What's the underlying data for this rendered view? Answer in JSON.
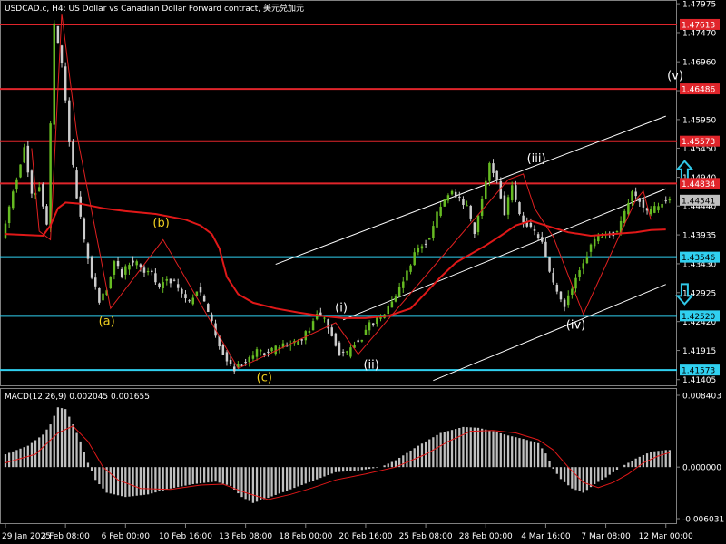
{
  "chart_data": {
    "type": "candlestick",
    "title": "USDCAD.c, H4:  US Dollar vs Canadian Dollar Forward contract, 美元兑加元",
    "price_axis": {
      "ylim": [
        1.4129,
        1.4804
      ],
      "ticks": [
        "1.47975",
        "1.47470",
        "1.46960",
        "1.46455",
        "1.45950",
        "1.45450",
        "1.44940",
        "1.44440",
        "1.43935",
        "1.43430",
        "1.42925",
        "1.42420",
        "1.41915",
        "1.41405"
      ]
    },
    "time_axis": {
      "labels": [
        "29 Jan 2025",
        "3 Feb 08:00",
        "6 Feb 00:00",
        "10 Feb 16:00",
        "13 Feb 08:00",
        "18 Feb 00:00",
        "20 Feb 16:00",
        "25 Feb 08:00",
        "28 Feb 00:00",
        "4 Mar 16:00",
        "7 Mar 08:00",
        "12 Mar 00:00"
      ],
      "positions": [
        0,
        16,
        32,
        48,
        64,
        80,
        96,
        112,
        128,
        144,
        160,
        176
      ]
    },
    "bars_count": 178,
    "current_price": "1.44541",
    "colors": {
      "up": "#66bb22",
      "down": "#cccccc",
      "background": "#000000",
      "resistance": "#e0252b",
      "support": "#30d0f0",
      "moving_average": "#e01818",
      "channel": "#ffffff",
      "histogram": "#c0c0c0",
      "signal": "#e01818",
      "arrows": "#30c8e8"
    },
    "price_anchors": [
      [
        0,
        1.4385
      ],
      [
        3,
        1.447
      ],
      [
        6,
        1.4545
      ],
      [
        8,
        1.446
      ],
      [
        10,
        1.448
      ],
      [
        12,
        1.441
      ],
      [
        14,
        1.476
      ],
      [
        16,
        1.469
      ],
      [
        18,
        1.456
      ],
      [
        20,
        1.446
      ],
      [
        22,
        1.438
      ],
      [
        24,
        1.432
      ],
      [
        26,
        1.4278
      ],
      [
        28,
        1.43
      ],
      [
        30,
        1.4345
      ],
      [
        32,
        1.4325
      ],
      [
        34,
        1.4345
      ],
      [
        36,
        1.4345
      ],
      [
        38,
        1.433
      ],
      [
        40,
        1.4325
      ],
      [
        42,
        1.43
      ],
      [
        44,
        1.432
      ],
      [
        46,
        1.431
      ],
      [
        48,
        1.429
      ],
      [
        50,
        1.4275
      ],
      [
        52,
        1.43
      ],
      [
        54,
        1.4275
      ],
      [
        56,
        1.424
      ],
      [
        58,
        1.42
      ],
      [
        60,
        1.4175
      ],
      [
        62,
        1.416
      ],
      [
        64,
        1.4168
      ],
      [
        66,
        1.418
      ],
      [
        68,
        1.4188
      ],
      [
        70,
        1.419
      ],
      [
        72,
        1.419
      ],
      [
        74,
        1.42
      ],
      [
        76,
        1.42
      ],
      [
        78,
        1.4205
      ],
      [
        80,
        1.421
      ],
      [
        82,
        1.423
      ],
      [
        84,
        1.4255
      ],
      [
        86,
        1.4245
      ],
      [
        88,
        1.422
      ],
      [
        90,
        1.419
      ],
      [
        92,
        1.4185
      ],
      [
        94,
        1.4205
      ],
      [
        96,
        1.4215
      ],
      [
        98,
        1.4235
      ],
      [
        100,
        1.4245
      ],
      [
        102,
        1.426
      ],
      [
        104,
        1.428
      ],
      [
        106,
        1.43
      ],
      [
        108,
        1.433
      ],
      [
        110,
        1.436
      ],
      [
        112,
        1.4375
      ],
      [
        114,
        1.439
      ],
      [
        116,
        1.443
      ],
      [
        118,
        1.4455
      ],
      [
        120,
        1.4465
      ],
      [
        122,
        1.4455
      ],
      [
        124,
        1.444
      ],
      [
        126,
        1.4395
      ],
      [
        128,
        1.4455
      ],
      [
        130,
        1.452
      ],
      [
        132,
        1.449
      ],
      [
        134,
        1.443
      ],
      [
        136,
        1.448
      ],
      [
        138,
        1.443
      ],
      [
        140,
        1.441
      ],
      [
        142,
        1.4395
      ],
      [
        144,
        1.438
      ],
      [
        146,
        1.433
      ],
      [
        148,
        1.429
      ],
      [
        150,
        1.427
      ],
      [
        152,
        1.43
      ],
      [
        154,
        1.433
      ],
      [
        156,
        1.436
      ],
      [
        158,
        1.4385
      ],
      [
        160,
        1.439
      ],
      [
        162,
        1.4395
      ],
      [
        164,
        1.44
      ],
      [
        166,
        1.443
      ],
      [
        168,
        1.447
      ],
      [
        170,
        1.4455
      ],
      [
        172,
        1.443
      ],
      [
        174,
        1.444
      ],
      [
        176,
        1.445
      ],
      [
        177,
        1.4454
      ]
    ],
    "moving_average": [
      [
        0,
        1.4395
      ],
      [
        10,
        1.4392
      ],
      [
        12,
        1.441
      ],
      [
        14,
        1.444
      ],
      [
        16,
        1.445
      ],
      [
        20,
        1.4448
      ],
      [
        26,
        1.444
      ],
      [
        32,
        1.4435
      ],
      [
        40,
        1.443
      ],
      [
        48,
        1.442
      ],
      [
        52,
        1.441
      ],
      [
        55,
        1.4395
      ],
      [
        57,
        1.437
      ],
      [
        59,
        1.432
      ],
      [
        62,
        1.429
      ],
      [
        66,
        1.4275
      ],
      [
        72,
        1.4265
      ],
      [
        78,
        1.4258
      ],
      [
        84,
        1.4252
      ],
      [
        90,
        1.4248
      ],
      [
        96,
        1.4248
      ],
      [
        102,
        1.4252
      ],
      [
        108,
        1.4265
      ],
      [
        112,
        1.4292
      ],
      [
        116,
        1.432
      ],
      [
        120,
        1.4345
      ],
      [
        124,
        1.436
      ],
      [
        128,
        1.4375
      ],
      [
        132,
        1.4392
      ],
      [
        136,
        1.441
      ],
      [
        140,
        1.4418
      ],
      [
        144,
        1.441
      ],
      [
        150,
        1.4398
      ],
      [
        156,
        1.4392
      ],
      [
        162,
        1.4395
      ],
      [
        168,
        1.4398
      ],
      [
        172,
        1.4402
      ],
      [
        176,
        1.4403
      ]
    ],
    "horizontal_levels": [
      {
        "label": "1.47613",
        "value": 1.47613,
        "kind": "resistance"
      },
      {
        "label": "1.46486",
        "value": 1.46486,
        "kind": "resistance"
      },
      {
        "label": "1.45573",
        "value": 1.45573,
        "kind": "resistance"
      },
      {
        "label": "1.44834",
        "value": 1.44834,
        "kind": "resistance"
      },
      {
        "label": "1.43546",
        "value": 1.43546,
        "kind": "support"
      },
      {
        "label": "1.42520",
        "value": 1.4252,
        "kind": "support"
      },
      {
        "label": "1.41573",
        "value": 1.41573,
        "kind": "support"
      }
    ],
    "channel_lines": [
      {
        "x1": 72,
        "y1": 1.4342,
        "x2": 176,
        "y2": 1.4601
      },
      {
        "x1": 114,
        "y1": 1.4139,
        "x2": 176,
        "y2": 1.4307
      },
      {
        "x1": 90,
        "y1": 1.4245,
        "x2": 176,
        "y2": 1.4474
      }
    ],
    "wave_path": [
      [
        7,
        1.4545
      ],
      [
        9,
        1.44
      ],
      [
        12,
        1.4385
      ],
      [
        15,
        1.478
      ],
      [
        19,
        1.457
      ],
      [
        28,
        1.4265
      ],
      [
        42,
        1.4385
      ],
      [
        62,
        1.416
      ],
      [
        88,
        1.424
      ],
      [
        94,
        1.4185
      ],
      [
        134,
        1.449
      ],
      [
        138,
        1.45
      ],
      [
        141,
        1.444
      ],
      [
        146,
        1.439
      ],
      [
        154,
        1.4255
      ],
      [
        168,
        1.4455
      ],
      [
        170,
        1.447
      ],
      [
        172,
        1.442
      ]
    ],
    "wave_labels": [
      {
        "text": "(a)",
        "x": 27,
        "y": 1.4236,
        "color": "#f0d020"
      },
      {
        "text": "(b)",
        "x": 41.5,
        "y": 1.4408,
        "color": "#f0d020"
      },
      {
        "text": "(c)",
        "x": 69,
        "y": 1.4138,
        "color": "#f0d020"
      },
      {
        "text": "(i)",
        "x": 89.5,
        "y": 1.426,
        "color": "#ffffff"
      },
      {
        "text": "(ii)",
        "x": 97.5,
        "y": 1.416,
        "color": "#ffffff"
      },
      {
        "text": "(iii)",
        "x": 141.5,
        "y": 1.452,
        "color": "#ffffff"
      },
      {
        "text": "(iv)",
        "x": 152,
        "y": 1.423,
        "color": "#ffffff"
      },
      {
        "text": "(v)",
        "x": 178.5,
        "y": 1.4665,
        "color": "#ffffff"
      }
    ],
    "arrows": [
      {
        "direction": "up",
        "x": 181,
        "y": 1.4505
      },
      {
        "direction": "down",
        "x": 181,
        "y": 1.429
      }
    ],
    "macd": {
      "label": "MACD(12,26,9) 0.002045 0.001655",
      "ylim": [
        -0.006031,
        0.008403
      ],
      "ticks": [
        "0.008403",
        "0.000000",
        "-0.006031"
      ],
      "histogram_anchors": [
        [
          0,
          0.0015
        ],
        [
          6,
          0.0025
        ],
        [
          10,
          0.0038
        ],
        [
          12,
          0.005
        ],
        [
          14,
          0.007
        ],
        [
          16,
          0.0068
        ],
        [
          18,
          0.005
        ],
        [
          20,
          0.003
        ],
        [
          22,
          0.0005
        ],
        [
          24,
          -0.0015
        ],
        [
          27,
          -0.003
        ],
        [
          32,
          -0.0035
        ],
        [
          38,
          -0.0032
        ],
        [
          44,
          -0.0025
        ],
        [
          50,
          -0.002
        ],
        [
          56,
          -0.0017
        ],
        [
          60,
          -0.0022
        ],
        [
          63,
          -0.0035
        ],
        [
          66,
          -0.0042
        ],
        [
          70,
          -0.0036
        ],
        [
          76,
          -0.0026
        ],
        [
          82,
          -0.0016
        ],
        [
          88,
          -0.0006
        ],
        [
          94,
          -0.0004
        ],
        [
          100,
          0.0
        ],
        [
          104,
          0.0008
        ],
        [
          110,
          0.0025
        ],
        [
          116,
          0.004
        ],
        [
          122,
          0.0047
        ],
        [
          126,
          0.0046
        ],
        [
          130,
          0.0042
        ],
        [
          134,
          0.0037
        ],
        [
          138,
          0.0033
        ],
        [
          142,
          0.0028
        ],
        [
          144,
          0.0016
        ],
        [
          146,
          -0.0002
        ],
        [
          148,
          -0.0014
        ],
        [
          151,
          -0.0025
        ],
        [
          154,
          -0.003
        ],
        [
          157,
          -0.002
        ],
        [
          160,
          -0.0012
        ],
        [
          164,
          0.0
        ],
        [
          168,
          0.001
        ],
        [
          172,
          0.0018
        ],
        [
          176,
          0.002
        ],
        [
          177,
          0.002
        ]
      ],
      "signal_anchors": [
        [
          0,
          0.0005
        ],
        [
          8,
          0.0015
        ],
        [
          14,
          0.004
        ],
        [
          18,
          0.0048
        ],
        [
          22,
          0.003
        ],
        [
          26,
          0.0
        ],
        [
          30,
          -0.0015
        ],
        [
          36,
          -0.0025
        ],
        [
          44,
          -0.0026
        ],
        [
          52,
          -0.0021
        ],
        [
          58,
          -0.002
        ],
        [
          64,
          -0.003
        ],
        [
          70,
          -0.0038
        ],
        [
          76,
          -0.0032
        ],
        [
          82,
          -0.0024
        ],
        [
          88,
          -0.0015
        ],
        [
          96,
          -0.0008
        ],
        [
          104,
          0.0
        ],
        [
          112,
          0.0015
        ],
        [
          118,
          0.003
        ],
        [
          124,
          0.0042
        ],
        [
          130,
          0.0043
        ],
        [
          136,
          0.004
        ],
        [
          142,
          0.0032
        ],
        [
          146,
          0.002
        ],
        [
          150,
          0.0
        ],
        [
          154,
          -0.0018
        ],
        [
          158,
          -0.0024
        ],
        [
          162,
          -0.0018
        ],
        [
          166,
          -0.0008
        ],
        [
          170,
          0.0005
        ],
        [
          174,
          0.0013
        ],
        [
          177,
          0.0017
        ]
      ]
    }
  }
}
